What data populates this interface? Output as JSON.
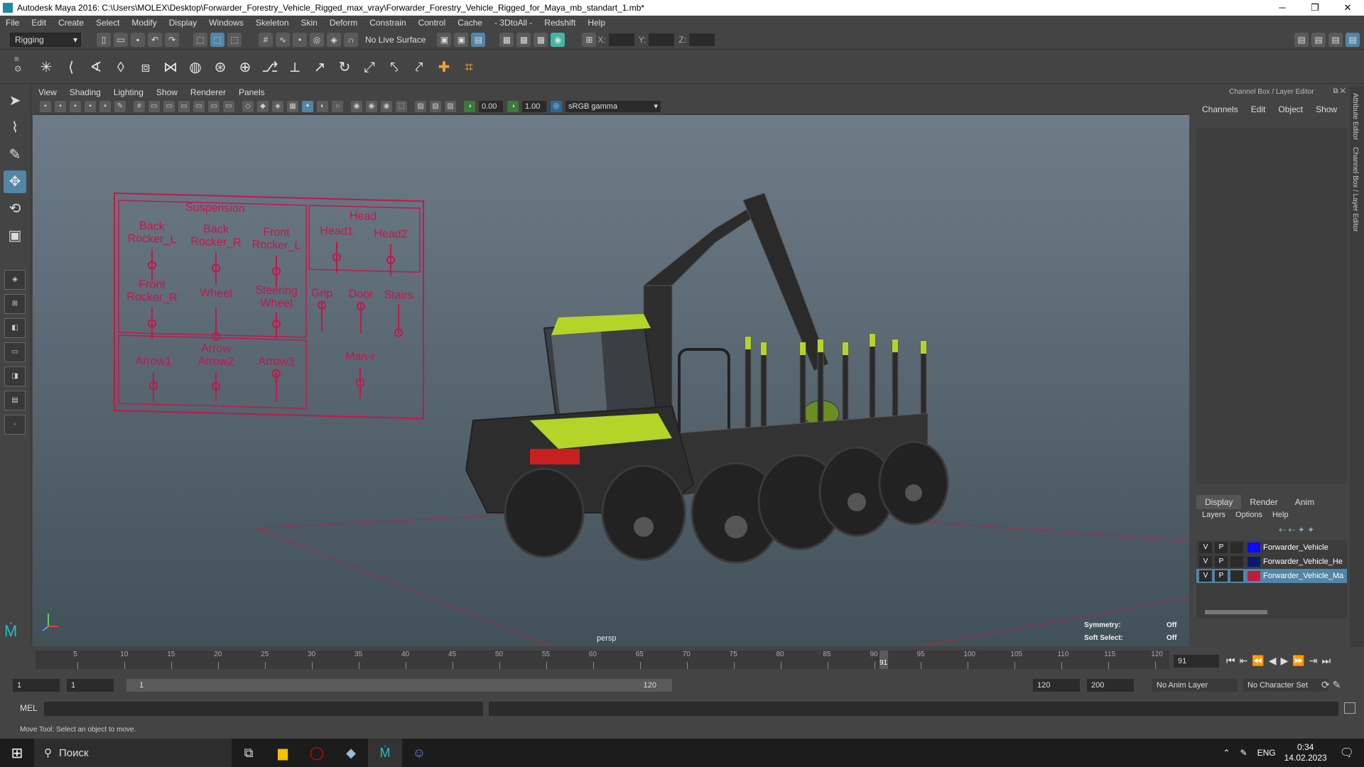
{
  "window": {
    "title": "Autodesk Maya 2016: C:\\Users\\MOLEX\\Desktop\\Forwarder_Forestry_Vehicle_Rigged_max_vray\\Forwarder_Forestry_Vehicle_Rigged_for_Maya_mb_standart_1.mb*",
    "min": "─",
    "max": "❐",
    "close": "✕"
  },
  "menu": [
    "File",
    "Edit",
    "Create",
    "Select",
    "Modify",
    "Display",
    "Windows",
    "Skeleton",
    "Skin",
    "Deform",
    "Constrain",
    "Control",
    "Cache",
    "- 3DtoAll -",
    "Redshift",
    "Help"
  ],
  "statusline": {
    "mode": "Rigging",
    "live_surface": "No Live Surface",
    "x_label": "X:",
    "y_label": "Y:",
    "z_label": "Z:"
  },
  "viewport_menu": [
    "View",
    "Shading",
    "Lighting",
    "Show",
    "Renderer",
    "Panels"
  ],
  "viewport_bar": {
    "value1": "0.00",
    "value2": "1.00",
    "gamma": "sRGB gamma"
  },
  "viewport": {
    "camera": "persp",
    "symmetry_label": "Symmetry:",
    "symmetry_value": "Off",
    "soft_select_label": "Soft Select:",
    "soft_select_value": "Off"
  },
  "control_panel": {
    "suspension_title": "Suspension",
    "head_title": "Head",
    "back_rocker_l": [
      "Back",
      "Rocker_L"
    ],
    "back_rocker_r": [
      "Back",
      "Rocker_R"
    ],
    "front_rocker_l": [
      "Front",
      "Rocker_L"
    ],
    "front_rocker_r": [
      "Front",
      "Rocker_R"
    ],
    "wheel": "Wheel",
    "steering_wheel": [
      "Steering",
      "Wheel"
    ],
    "head1": "Head1",
    "head2": "Head2",
    "grip": "Grip",
    "door": "Door",
    "stairs": "Stairs",
    "arrow_title": "Arrow",
    "arrow1": "Arrow1",
    "arrow2": "Arrow2",
    "arrow3": "Arrow3",
    "man": "Man-r"
  },
  "channel_box": {
    "header": "Channel Box / Layer Editor",
    "menu": [
      "Channels",
      "Edit",
      "Object",
      "Show"
    ],
    "layer_tabs": [
      "Display",
      "Render",
      "Anim"
    ],
    "layer_menu": [
      "Layers",
      "Options",
      "Help"
    ]
  },
  "layers": [
    {
      "v": "V",
      "p": "P",
      "name": "Forwarder_Vehicle",
      "color": "#0a0aff",
      "selected": false
    },
    {
      "v": "V",
      "p": "P",
      "name": "Forwarder_Vehicle_He",
      "color": "#0a1a6e",
      "selected": false
    },
    {
      "v": "V",
      "p": "P",
      "name": "Forwarder_Vehicle_Ma",
      "color": "#c21a40",
      "selected": true
    }
  ],
  "side_tabs": [
    "Attribute Editor",
    "Channel Box / Layer Editor"
  ],
  "timeline": {
    "ticks": [
      "5",
      "10",
      "15",
      "20",
      "25",
      "30",
      "35",
      "40",
      "45",
      "50",
      "55",
      "60",
      "65",
      "70",
      "75",
      "80",
      "85",
      "90",
      "95",
      "100",
      "105",
      "110",
      "115",
      "120"
    ],
    "current": "91",
    "current_field": "91"
  },
  "range": {
    "start": "1",
    "start2": "1",
    "range_start": "1",
    "range_end": "120",
    "end": "120",
    "end2": "200",
    "anim_layer": "No Anim Layer",
    "char_set": "No Character Set"
  },
  "mel": {
    "label": "MEL"
  },
  "help": "Move Tool: Select an object to move.",
  "taskbar": {
    "search": "Поиск",
    "lang": "ENG",
    "time": "0:34",
    "date": "14.02.2023"
  }
}
